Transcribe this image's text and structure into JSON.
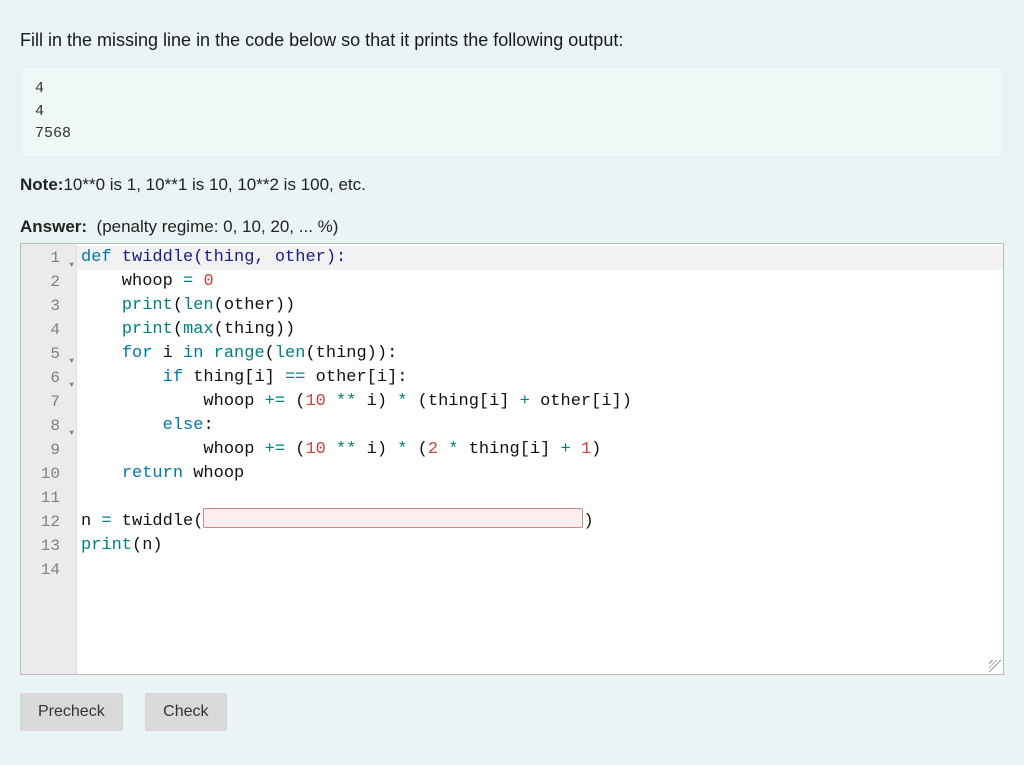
{
  "prompt": "Fill in the missing line in the code below so that it prints the following output:",
  "expected_output": "4\n4\n7568",
  "note_label": "Note:",
  "note_text": "10**0 is 1, 10**1 is 10, 10**2 is 100, etc.",
  "answer_label": "Answer:",
  "penalty_text": "(penalty regime: 0, 10, 20, ... %)",
  "gutter": {
    "lines": [
      "1",
      "2",
      "3",
      "4",
      "5",
      "6",
      "7",
      "8",
      "9",
      "10",
      "11",
      "12",
      "13",
      "14"
    ],
    "fold_rows": [
      0,
      4,
      5,
      7
    ]
  },
  "code": {
    "l1_def": "def",
    "l1_name": " twiddle(thing, other):",
    "l2": "    whoop ",
    "l2_eq": "=",
    "l2_sp": " ",
    "l2_val": "0",
    "l3_ind": "    ",
    "l3_print": "print",
    "l3_open": "(",
    "l3_len": "len",
    "l3_arg": "(other))",
    "l4_ind": "    ",
    "l4_print": "print",
    "l4_open": "(",
    "l4_max": "max",
    "l4_arg": "(thing))",
    "l5_ind": "    ",
    "l5_for": "for",
    "l5_i": " i ",
    "l5_in": "in",
    "l5_sp": " ",
    "l5_range": "range",
    "l5_open": "(",
    "l5_len": "len",
    "l5_arg": "(thing)):",
    "l6_ind": "        ",
    "l6_if": "if",
    "l6_rest": " thing[i] ",
    "l6_eq": "==",
    "l6_rest2": " other[i]:",
    "l7_ind": "            whoop ",
    "l7_pe": "+=",
    "l7_a": " (",
    "l7_10": "10",
    "l7_pow": " ** ",
    "l7_i": "i) ",
    "l7_mul": "*",
    "l7_b": " (thing[i] ",
    "l7_plus": "+",
    "l7_c": " other[i])",
    "l8_ind": "        ",
    "l8_else": "else",
    "l8_colon": ":",
    "l9_ind": "            whoop ",
    "l9_pe": "+=",
    "l9_a": " (",
    "l9_10": "10",
    "l9_pow": " ** ",
    "l9_i": "i) ",
    "l9_mul": "*",
    "l9_b": " (",
    "l9_2": "2",
    "l9_mul2": " * ",
    "l9_c": "thing[i] ",
    "l9_plus": "+",
    "l9_sp": " ",
    "l9_1": "1",
    "l9_close": ")",
    "l10_ind": "    ",
    "l10_ret": "return",
    "l10_rest": " whoop",
    "l12_a": "n ",
    "l12_eq": "=",
    "l12_b": " twiddle(",
    "l12_close": ")",
    "l13_print": "print",
    "l13_arg": "(n)",
    "fill_value": ""
  },
  "buttons": {
    "precheck": "Precheck",
    "check": "Check"
  }
}
